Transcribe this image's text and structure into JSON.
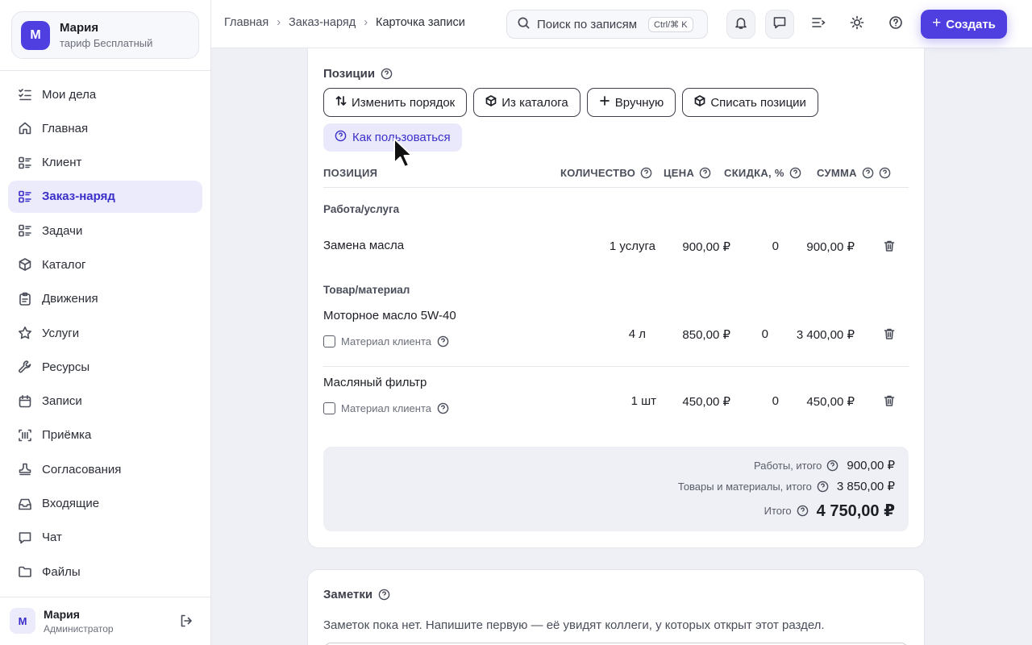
{
  "org": {
    "initial": "М",
    "name": "Мария",
    "plan": "тариф Бесплатный"
  },
  "nav": [
    {
      "label": "Мои дела",
      "icon": "task-list-icon"
    },
    {
      "label": "Главная",
      "icon": "home-icon"
    },
    {
      "label": "Клиент",
      "icon": "list-icon"
    },
    {
      "label": "Заказ-наряд",
      "icon": "list-icon",
      "active": true
    },
    {
      "label": "Задачи",
      "icon": "list-icon"
    },
    {
      "label": "Каталог",
      "icon": "box-icon"
    },
    {
      "label": "Движения",
      "icon": "clipboard-icon"
    },
    {
      "label": "Услуги",
      "icon": "star-icon"
    },
    {
      "label": "Ресурсы",
      "icon": "wrench-icon"
    },
    {
      "label": "Записи",
      "icon": "calendar-icon"
    },
    {
      "label": "Приёмка",
      "icon": "scan-icon"
    },
    {
      "label": "Согласования",
      "icon": "stamp-icon"
    },
    {
      "label": "Входящие",
      "icon": "inbox-icon"
    },
    {
      "label": "Чат",
      "icon": "chat-icon"
    },
    {
      "label": "Файлы",
      "icon": "folder-icon"
    }
  ],
  "user": {
    "initial": "М",
    "name": "Мария",
    "role": "Администратор"
  },
  "header": {
    "breadcrumbs": [
      "Главная",
      "Заказ-наряд",
      "Карточка записи"
    ],
    "search_placeholder": "Поиск по записям",
    "search_shortcut": "Ctrl/⌘ K",
    "create_label": "Создать"
  },
  "positions": {
    "title": "Позиции",
    "buttons": {
      "reorder": "Изменить порядок",
      "from_catalog": "Из каталога",
      "manual": "Вручную",
      "write_off": "Списать позиции"
    },
    "howto": "Как пользоваться",
    "columns": {
      "position": "ПОЗИЦИЯ",
      "quantity": "КОЛИЧЕСТВО",
      "price": "ЦЕНА",
      "discount": "СКИДКА, %",
      "sum": "СУММА"
    },
    "groups": {
      "work": "Работа/услуга",
      "goods": "Товар/материал"
    },
    "client_material_label": "Материал клиента",
    "rows": [
      {
        "name": "Замена масла",
        "qty": "1 услуга",
        "price": "900,00 ₽",
        "discount": "0",
        "sum": "900,00 ₽"
      },
      {
        "name": "Моторное масло 5W-40",
        "qty": "4 л",
        "price": "850,00 ₽",
        "discount": "0",
        "sum": "3 400,00 ₽"
      },
      {
        "name": "Масляный фильтр",
        "qty": "1 шт",
        "price": "450,00 ₽",
        "discount": "0",
        "sum": "450,00 ₽"
      }
    ],
    "totals": {
      "works_label": "Работы, итого",
      "works_value": "900,00 ₽",
      "goods_label": "Товары и материалы, итого",
      "goods_value": "3 850,00 ₽",
      "grand_label": "Итого",
      "grand_value": "4 750,00 ₽"
    }
  },
  "notes": {
    "title": "Заметки",
    "empty_text": "Заметок пока нет. Напишите первую — её увидят коллеги, у которых открыт этот раздел."
  },
  "colors": {
    "accent": "#4f3fe0",
    "active_bg": "#ebebfb",
    "page_bg": "#eef0f5"
  }
}
